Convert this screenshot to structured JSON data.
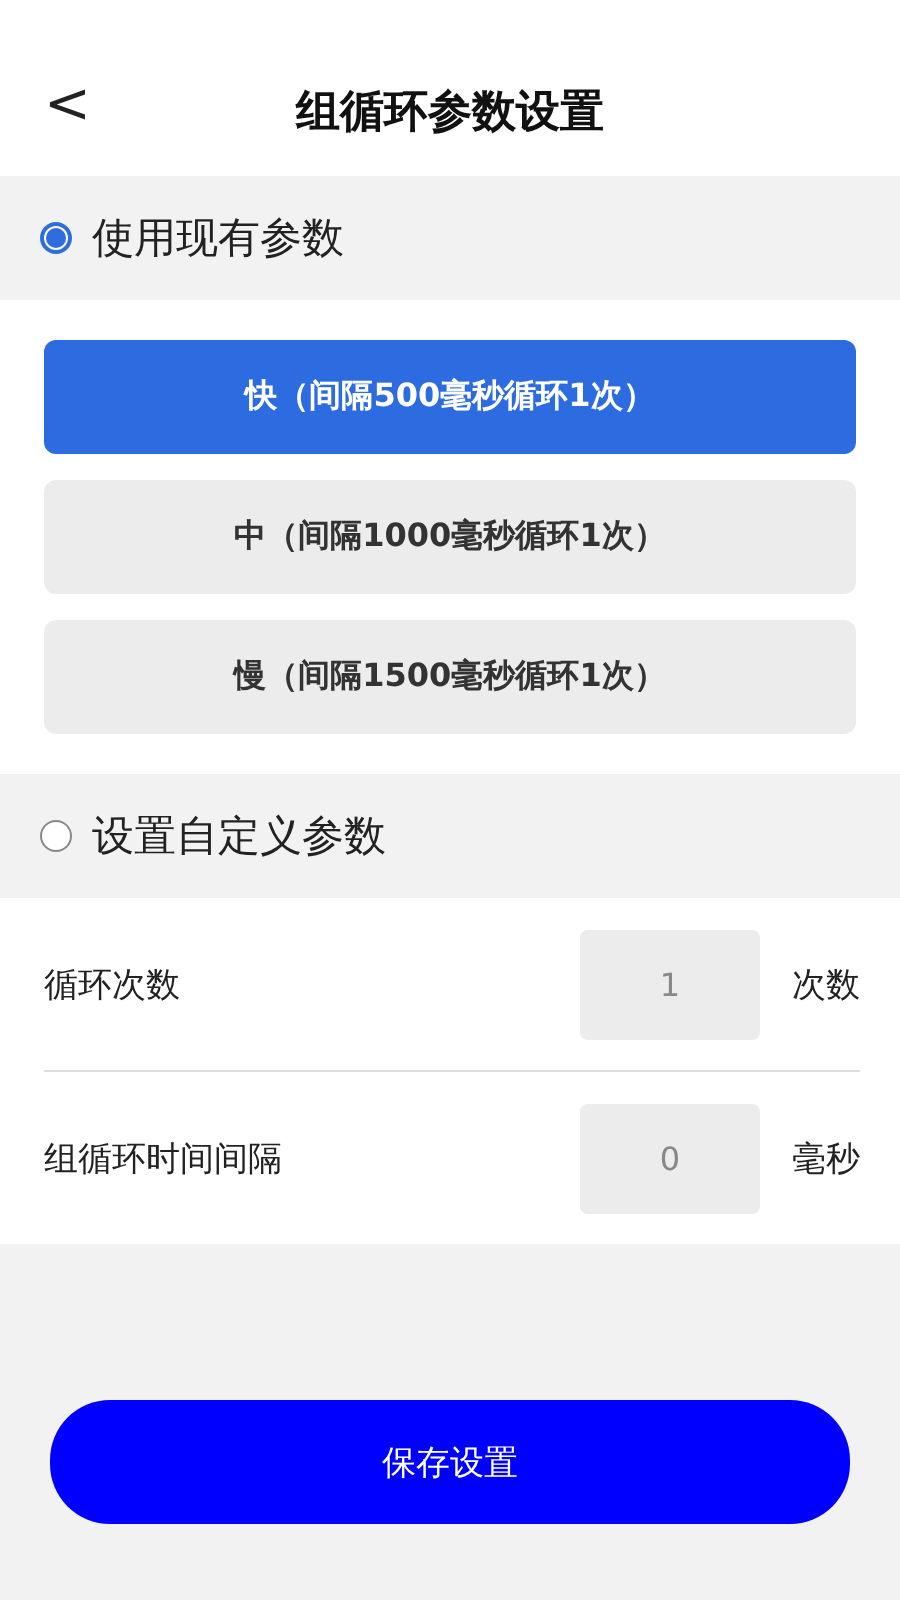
{
  "header": {
    "back": "<",
    "title": "组循环参数设置"
  },
  "preset_section": {
    "label": "使用现有参数",
    "selected": true,
    "options": [
      {
        "label": "快（间隔500毫秒循环1次）",
        "selected": true
      },
      {
        "label": "中（间隔1000毫秒循环1次）",
        "selected": false
      },
      {
        "label": "慢（间隔1500毫秒循环1次）",
        "selected": false
      }
    ]
  },
  "custom_section": {
    "label": "设置自定义参数",
    "selected": false,
    "rows": [
      {
        "label": "循环次数",
        "value": "1",
        "unit": "次数"
      },
      {
        "label": "组循环时间间隔",
        "value": "0",
        "unit": "毫秒"
      }
    ]
  },
  "save_button": "保存设置"
}
